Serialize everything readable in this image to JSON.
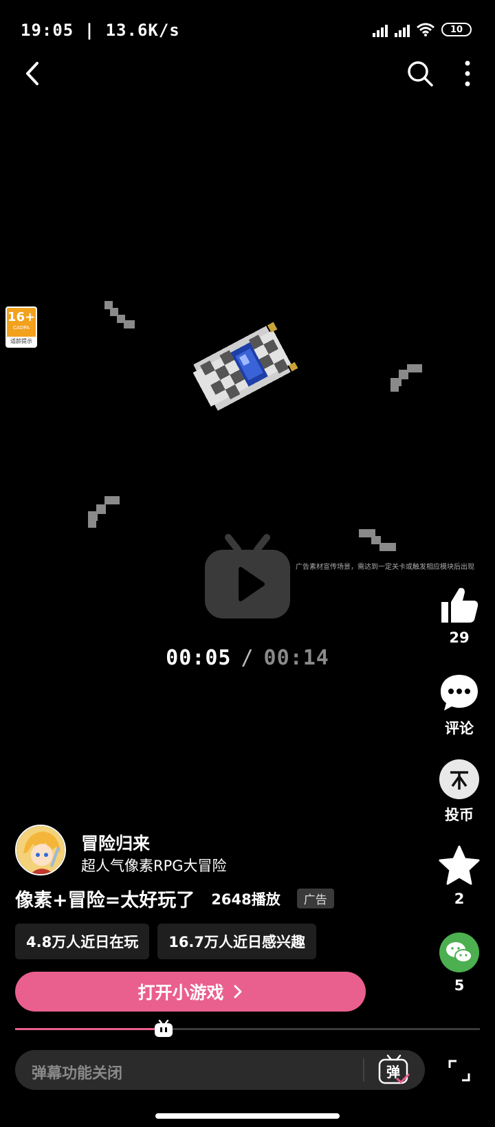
{
  "status_bar": {
    "time": "19:05 | 13.6K/s",
    "battery": "10"
  },
  "age_rating": {
    "rating": "16+",
    "org": "CADPA",
    "tip": "适龄提示"
  },
  "ad_disclaimer": "广告素材宣传场景，需达到一定关卡或触发相应模块后出现",
  "player": {
    "current_time": "00:05",
    "separator": "/",
    "total_time": "00:14",
    "progress_fraction": 0.32
  },
  "actions": {
    "like_count": "29",
    "comment_label": "评论",
    "coin_label": "投币",
    "favorite_count": "2",
    "share_count": "5"
  },
  "game": {
    "name": "冒险归来",
    "subtitle": "超人气像素RPG大冒险"
  },
  "video": {
    "title": "像素+冒险=太好玩了",
    "play_count": "2648播放",
    "ad_badge": "广告"
  },
  "stats": [
    "4.8万人近日在玩",
    "16.7万人近日感兴趣"
  ],
  "open_button_label": "打开小游戏",
  "danmaku": {
    "placeholder": "弹幕功能关闭",
    "toggle_glyph": "弹"
  },
  "colors": {
    "accent_pink": "#e95f8e",
    "share_green": "#4caf50"
  }
}
